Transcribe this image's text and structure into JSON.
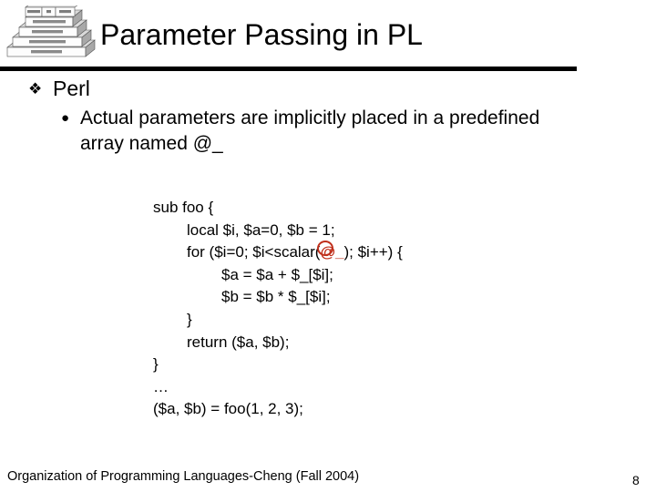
{
  "slide": {
    "title": "Parameter Passing in PL",
    "logo": {
      "name": "programming-language-layers-pyramid",
      "tiers": [
        [
          "FORTRAN",
          "C",
          "Pascal"
        ],
        [
          "High-level language"
        ],
        [
          "Assembly language"
        ],
        [
          "Machine language"
        ],
        [
          "Hardware"
        ]
      ]
    },
    "bullets": [
      {
        "level": 1,
        "glyph": "❖",
        "glyph_name": "diamond-bullet-icon",
        "text": "Perl"
      },
      {
        "level": 2,
        "glyph": "●",
        "glyph_name": "round-bullet-icon",
        "text": "Actual parameters are implicitly placed in a predefined array named @_"
      }
    ],
    "code": {
      "lines": [
        {
          "indent": 0,
          "text": "sub foo {"
        },
        {
          "indent": 1,
          "text": "local $i, $a=0, $b = 1;"
        },
        {
          "indent": 1,
          "pre": "for ($i=0; $i<scalar(",
          "highlight": "@_",
          "post": "); $i++) {"
        },
        {
          "indent": 2,
          "text": "$a = $a + $_[$i];"
        },
        {
          "indent": 2,
          "text": "$b = $b * $_[$i];"
        },
        {
          "indent": 1,
          "text": "}"
        },
        {
          "indent": 1,
          "text": "return ($a, $b);"
        },
        {
          "indent": 0,
          "text": "}"
        },
        {
          "indent": 0,
          "text": "…"
        },
        {
          "indent": 0,
          "text": "($a, $b) = foo(1, 2, 3);"
        }
      ],
      "highlight_color": "#c0301c"
    },
    "footer": {
      "text": "Organization of Programming Languages-Cheng (Fall 2004)",
      "page_number": "8"
    }
  }
}
